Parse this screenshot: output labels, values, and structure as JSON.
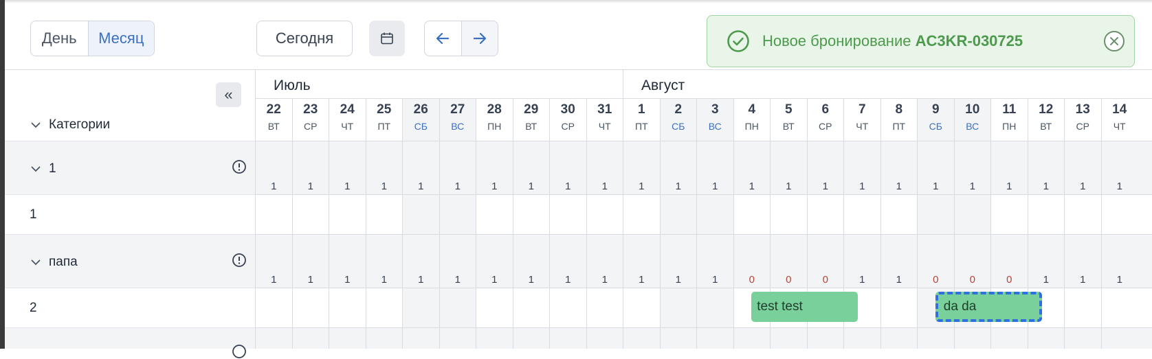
{
  "toolbar": {
    "view_day": "День",
    "view_month": "Месяц",
    "today": "Сегодня"
  },
  "toast": {
    "text": "Новое бронирование ",
    "code": "AC3KR-030725"
  },
  "sidebar": {
    "collapse_label": "«",
    "categories_label": "Категории",
    "rows": [
      {
        "label": "1",
        "type": "group"
      },
      {
        "label": "1",
        "type": "item"
      },
      {
        "label": "папа",
        "type": "group"
      },
      {
        "label": "2",
        "type": "item"
      }
    ]
  },
  "calendar": {
    "months": [
      "Июль",
      "Август"
    ],
    "days": [
      {
        "n": "22",
        "wd": "ВТ",
        "w": false
      },
      {
        "n": "23",
        "wd": "СР",
        "w": false
      },
      {
        "n": "24",
        "wd": "ЧТ",
        "w": false
      },
      {
        "n": "25",
        "wd": "ПТ",
        "w": false
      },
      {
        "n": "26",
        "wd": "СБ",
        "w": true
      },
      {
        "n": "27",
        "wd": "ВС",
        "w": true
      },
      {
        "n": "28",
        "wd": "ПН",
        "w": false
      },
      {
        "n": "29",
        "wd": "ВТ",
        "w": false
      },
      {
        "n": "30",
        "wd": "СР",
        "w": false
      },
      {
        "n": "31",
        "wd": "ЧТ",
        "w": false
      },
      {
        "n": "1",
        "wd": "ПТ",
        "w": false
      },
      {
        "n": "2",
        "wd": "СБ",
        "w": true
      },
      {
        "n": "3",
        "wd": "ВС",
        "w": true
      },
      {
        "n": "4",
        "wd": "ПН",
        "w": false
      },
      {
        "n": "5",
        "wd": "ВТ",
        "w": false
      },
      {
        "n": "6",
        "wd": "СР",
        "w": false
      },
      {
        "n": "7",
        "wd": "ЧТ",
        "w": false
      },
      {
        "n": "8",
        "wd": "ПТ",
        "w": false
      },
      {
        "n": "9",
        "wd": "СБ",
        "w": true
      },
      {
        "n": "10",
        "wd": "ВС",
        "w": true
      },
      {
        "n": "11",
        "wd": "ПН",
        "w": false
      },
      {
        "n": "12",
        "wd": "ВТ",
        "w": false
      },
      {
        "n": "13",
        "wd": "СР",
        "w": false
      },
      {
        "n": "14",
        "wd": "ЧТ",
        "w": false
      }
    ],
    "counts_group1": [
      "1",
      "1",
      "1",
      "1",
      "1",
      "1",
      "1",
      "1",
      "1",
      "1",
      "1",
      "1",
      "1",
      "1",
      "1",
      "1",
      "1",
      "1",
      "1",
      "1",
      "1",
      "1",
      "1",
      "1"
    ],
    "counts_group2": [
      "1",
      "1",
      "1",
      "1",
      "1",
      "1",
      "1",
      "1",
      "1",
      "1",
      "1",
      "1",
      "1",
      "0",
      "0",
      "0",
      "1",
      "1",
      "0",
      "0",
      "0",
      "1",
      "1",
      "1"
    ],
    "bookings": [
      {
        "label": "test test",
        "selected": false
      },
      {
        "label": "da da",
        "selected": true
      }
    ]
  },
  "colors": {
    "accent": "#3b6fc0",
    "booking": "#79d09a",
    "toast_bg": "#e8f5e8",
    "zero": "#b4453a"
  }
}
